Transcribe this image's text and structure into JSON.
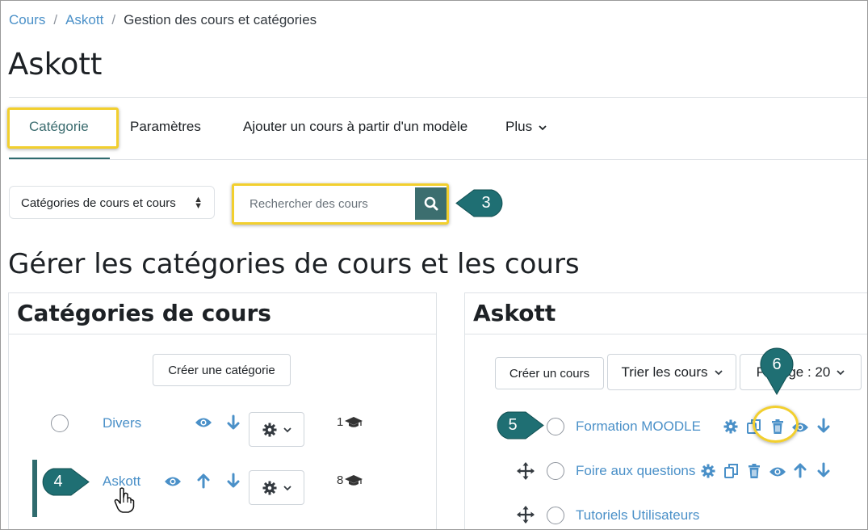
{
  "breadcrumb": {
    "items": [
      "Cours",
      "Askott"
    ],
    "current": "Gestion des cours et catégories"
  },
  "page_title": "Askott",
  "nav": {
    "tabs": [
      "Catégorie",
      "Paramètres",
      "Ajouter un cours à partir d'un modèle",
      "Plus"
    ]
  },
  "view_select": {
    "value": "Catégories de cours et cours"
  },
  "search": {
    "placeholder": "Rechercher des cours"
  },
  "section_title": "Gérer les catégories de cours et les cours",
  "categories_panel": {
    "title": "Catégories de cours",
    "create_button": "Créer une catégorie",
    "items": [
      {
        "name": "Divers",
        "count": "1"
      },
      {
        "name": "Askott",
        "count": "8"
      }
    ]
  },
  "courses_panel": {
    "title": "Askott",
    "create_button": "Créer un cours",
    "sort_button": "Trier les cours",
    "paging_button": "Pa    ge : 20",
    "courses": [
      {
        "name": "Formation MOODLE"
      },
      {
        "name": "Foire aux questions"
      },
      {
        "name": "Tutoriels Utilisateurs"
      }
    ]
  },
  "callouts": [
    "3",
    "4",
    "5",
    "6"
  ],
  "colors": {
    "link": "#4a90c8",
    "accent": "#3c6e6f",
    "highlight": "#f2cf2e"
  },
  "icons": [
    "search-icon",
    "eye-icon",
    "arrow-up-icon",
    "arrow-down-icon",
    "gear-icon",
    "chevron-down-icon",
    "graduation-cap-icon",
    "move-icon",
    "copy-icon",
    "trash-icon",
    "hand-cursor-icon"
  ]
}
